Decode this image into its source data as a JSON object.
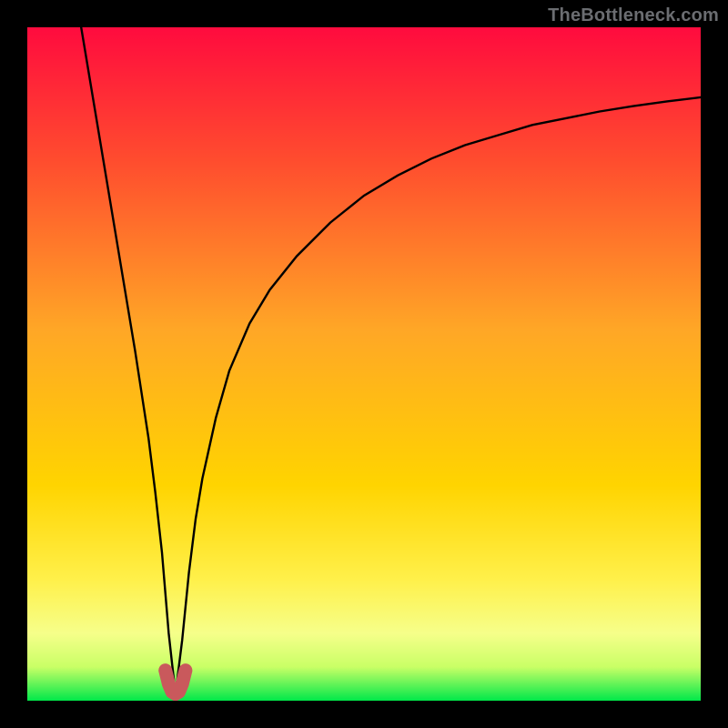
{
  "watermark": "TheBottleneck.com",
  "colors": {
    "frame": "#000000",
    "grad_top": "#ff0b3e",
    "grad_mid": "#ffcc00",
    "grad_low": "#ffff66",
    "grad_band": "#f4ff9c",
    "grad_bottom": "#00e84a",
    "curve": "#000000",
    "marker": "#c9595c"
  },
  "chart_data": {
    "type": "line",
    "title": "",
    "xlabel": "",
    "ylabel": "",
    "xlim": [
      0,
      100
    ],
    "ylim": [
      0,
      100
    ],
    "x_optimum": 22,
    "series": [
      {
        "name": "bottleneck-curve",
        "x": [
          8,
          10,
          12,
          14,
          16,
          18,
          19,
          20,
          21,
          22,
          23,
          24,
          25,
          26,
          28,
          30,
          33,
          36,
          40,
          45,
          50,
          55,
          60,
          65,
          70,
          75,
          80,
          85,
          90,
          95,
          100
        ],
        "values": [
          100,
          88,
          76,
          64,
          52,
          39,
          31,
          22,
          10,
          1,
          9,
          19,
          27,
          33,
          42,
          49,
          56,
          61,
          66,
          71,
          75,
          78,
          80.5,
          82.5,
          84,
          85.5,
          86.5,
          87.5,
          88.3,
          89,
          89.6
        ]
      }
    ],
    "markers": {
      "name": "highlight-near-minimum",
      "x": [
        20.5,
        21,
        21.5,
        22,
        22.5,
        23,
        23.5
      ],
      "values": [
        4.5,
        2.5,
        1.3,
        1,
        1.3,
        2.5,
        4.5
      ]
    }
  }
}
